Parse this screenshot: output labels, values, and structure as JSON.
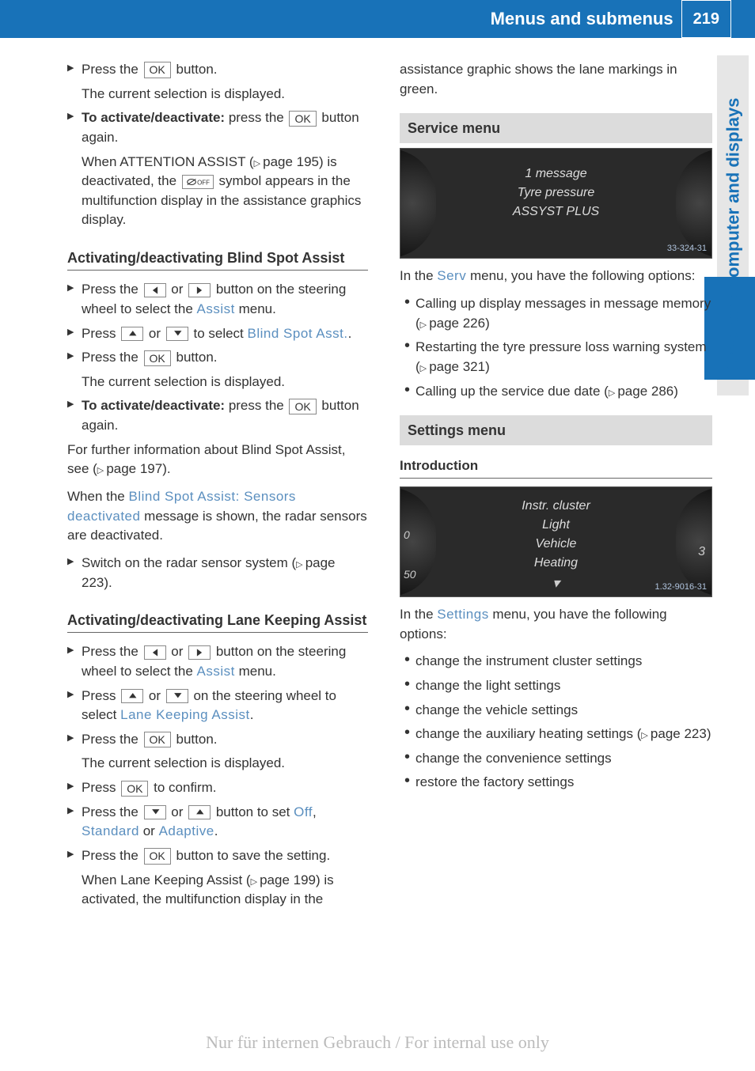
{
  "header": {
    "title": "Menus and submenus",
    "page": "219"
  },
  "side_label": "On-board computer and displays",
  "left": {
    "intro": [
      {
        "type": "step",
        "parts": [
          "Press the ",
          {
            "kbd": "OK"
          },
          " button."
        ]
      },
      {
        "type": "indent",
        "text": "The current selection is displayed."
      },
      {
        "type": "step",
        "parts": [
          {
            "b": "To activate/deactivate:"
          },
          " press the ",
          {
            "kbd": "OK"
          },
          " button again."
        ]
      },
      {
        "type": "indent",
        "parts": [
          "When ATTENTION ASSIST (",
          {
            "ref": "page 195"
          },
          ") is deactivated, the ",
          {
            "kbdimg": "off"
          },
          " symbol appears in the multifunction display in the assistance graphics display."
        ]
      }
    ],
    "blind_heading": "Activating/deactivating Blind Spot Assist",
    "blind": [
      {
        "type": "step",
        "parts": [
          "Press the ",
          {
            "kbdimg": "left"
          },
          " or ",
          {
            "kbdimg": "right"
          },
          " button on the steering wheel to select the ",
          {
            "menu": "Assist"
          },
          " menu."
        ]
      },
      {
        "type": "step",
        "parts": [
          "Press ",
          {
            "kbdimg": "up"
          },
          " or ",
          {
            "kbdimg": "down"
          },
          " to select ",
          {
            "menu": "Blind Spot Asst."
          },
          "."
        ]
      },
      {
        "type": "step",
        "parts": [
          "Press the ",
          {
            "kbd": "OK"
          },
          " button."
        ]
      },
      {
        "type": "indent",
        "text": "The current selection is displayed."
      },
      {
        "type": "step",
        "parts": [
          {
            "b": "To activate/deactivate:"
          },
          " press the ",
          {
            "kbd": "OK"
          },
          " button again."
        ]
      }
    ],
    "blind_p1_parts": [
      "For further information about Blind Spot Assist, see (",
      {
        "ref": "page 197"
      },
      ")."
    ],
    "blind_p2_parts": [
      "When the ",
      {
        "menu": "Blind Spot Assist: Sensors deactivated"
      },
      " message is shown, the radar sensors are deactivated."
    ],
    "blind_p3": [
      {
        "type": "step",
        "parts": [
          "Switch on the radar sensor system (",
          {
            "ref": "page 223"
          },
          ")."
        ]
      }
    ],
    "lane_heading": "Activating/deactivating Lane Keeping Assist",
    "lane": [
      {
        "type": "step",
        "parts": [
          "Press the ",
          {
            "kbdimg": "left"
          },
          " or ",
          {
            "kbdimg": "right"
          },
          " button on the steering wheel to select the ",
          {
            "menu": "Assist"
          },
          " menu."
        ]
      },
      {
        "type": "step",
        "parts": [
          "Press ",
          {
            "kbdimg": "up"
          },
          " or ",
          {
            "kbdimg": "down"
          },
          " on the steering wheel to select ",
          {
            "menu": "Lane Keeping Assist"
          },
          "."
        ]
      },
      {
        "type": "step",
        "parts": [
          "Press the ",
          {
            "kbd": "OK"
          },
          " button."
        ]
      },
      {
        "type": "indent",
        "text": "The current selection is displayed."
      },
      {
        "type": "step",
        "parts": [
          "Press ",
          {
            "kbd": "OK"
          },
          " to confirm."
        ]
      },
      {
        "type": "step",
        "parts": [
          "Press the ",
          {
            "kbdimg": "down"
          },
          " or ",
          {
            "kbdimg": "up"
          },
          " button to set ",
          {
            "menu": "Off"
          },
          ", ",
          {
            "menu": "Standard"
          },
          " or ",
          {
            "menu": "Adaptive"
          },
          "."
        ]
      },
      {
        "type": "step",
        "parts": [
          "Press the ",
          {
            "kbd": "OK"
          },
          " button to save the setting."
        ]
      },
      {
        "type": "indent",
        "parts": [
          "When Lane Keeping Assist (",
          {
            "ref": "page 199"
          },
          ") is activated, the multifunction display in the"
        ]
      }
    ]
  },
  "right": {
    "cont": "assistance graphic shows the lane markings in green.",
    "service_hdr": "Service menu",
    "service_display": {
      "l1": "1 message",
      "l2": "Tyre pressure",
      "l3": "ASSYST PLUS",
      "code": "33-324-31"
    },
    "service_intro_parts": [
      "In the ",
      {
        "menu": "Serv"
      },
      " menu, you have the following options:"
    ],
    "service_bullets": [
      {
        "parts": [
          "Calling up display messages in message memory (",
          {
            "ref": "page 226"
          },
          ")"
        ]
      },
      {
        "parts": [
          "Restarting the tyre pressure loss warning system (",
          {
            "ref": "page 321"
          },
          ")"
        ]
      },
      {
        "parts": [
          "Calling up the service due date (",
          {
            "ref": "page 286"
          },
          ")"
        ]
      }
    ],
    "settings_hdr": "Settings menu",
    "settings_sub": "Introduction",
    "settings_display": {
      "l1": "Instr. cluster",
      "l2": "Light",
      "l3": "Vehicle",
      "l4": "Heating",
      "code": "1.32-9016-31",
      "left_ticks": [
        "0",
        "50"
      ],
      "right_ticks": [
        "3"
      ]
    },
    "settings_intro_parts": [
      "In the ",
      {
        "menu": "Settings"
      },
      " menu, you have the following options:"
    ],
    "settings_bullets": [
      {
        "text": "change the instrument cluster settings"
      },
      {
        "text": "change the light settings"
      },
      {
        "text": "change the vehicle settings"
      },
      {
        "parts": [
          "change the auxiliary heating settings (",
          {
            "ref": "page 223"
          },
          ")"
        ]
      },
      {
        "text": "change the convenience settings"
      },
      {
        "text": "restore the factory settings"
      }
    ]
  },
  "watermark": "Nur für internen Gebrauch / For internal use only"
}
